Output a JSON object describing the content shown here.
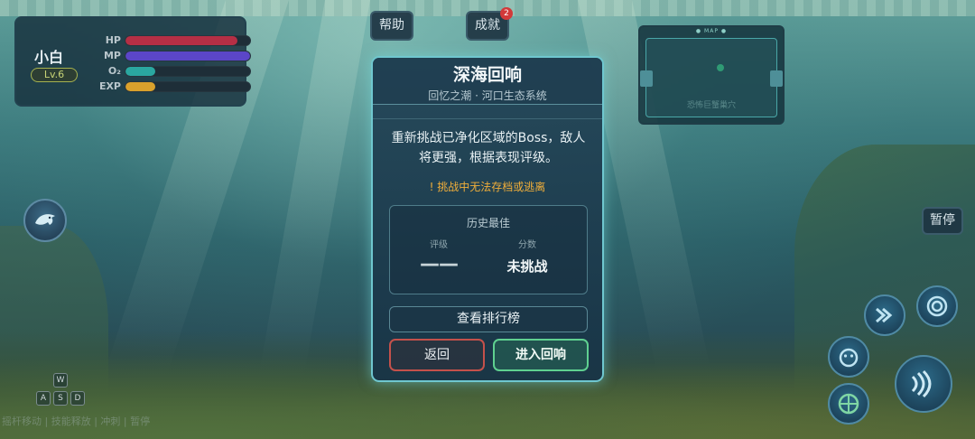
{
  "player": {
    "name": "小白",
    "level": "Lv.6",
    "stats": [
      {
        "label": "HP",
        "fraction": 0.9,
        "color": "#b52f45"
      },
      {
        "label": "MP",
        "fraction": 1.0,
        "color": "#5b46c8"
      },
      {
        "label": "O₂",
        "fraction": 0.24,
        "color": "#2aa7a0"
      },
      {
        "label": "EXP",
        "fraction": 0.24,
        "color": "#d9a12c"
      }
    ]
  },
  "top_buttons": {
    "help_label": "帮助",
    "achievements_label": "成就",
    "achievements_badge": "2"
  },
  "minimap": {
    "tag": "● MAP ●",
    "caption": "恐怖巨蟹巢穴"
  },
  "pause_label": "暂停",
  "companion_icon": "dolphin-icon",
  "keys": {
    "up": "W",
    "left": "A",
    "down": "S",
    "right": "D"
  },
  "control_hint": "摇杆移动 | 技能释放 | 冲刺 | 暂停",
  "modal": {
    "title": "深海回响",
    "subtitle": "回忆之潮 · 河口生态系统",
    "description": "重新挑战已净化区域的Boss，敌人将更强，根据表现评级。",
    "warning": "! 挑战中无法存档或逃离",
    "best": {
      "title": "历史最佳",
      "rating_label": "评级",
      "rating_value": "——",
      "score_label": "分数",
      "score_value": "未挑战"
    },
    "leaderboard_label": "查看排行榜",
    "back_label": "返回",
    "enter_label": "进入回响"
  }
}
